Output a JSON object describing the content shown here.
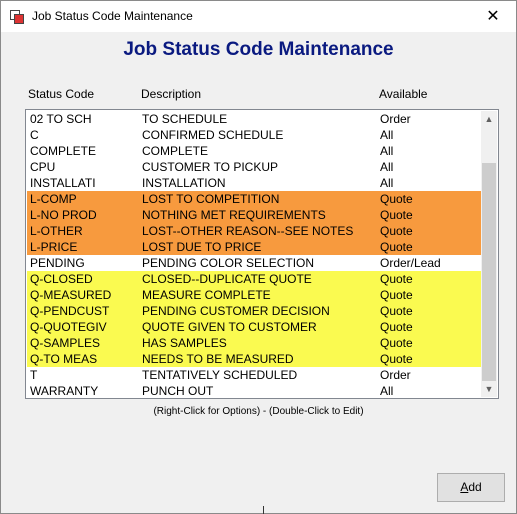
{
  "window": {
    "title": "Job Status Code Maintenance",
    "close_glyph": "✕"
  },
  "heading": "Job Status Code Maintenance",
  "columns": {
    "code": "Status Code",
    "description": "Description",
    "available": "Available"
  },
  "rows": [
    {
      "code": "02 TO SCH",
      "description": "TO SCHEDULE",
      "available": "Order",
      "highlight": "none"
    },
    {
      "code": "C",
      "description": "CONFIRMED SCHEDULE",
      "available": "All",
      "highlight": "none"
    },
    {
      "code": "COMPLETE",
      "description": "COMPLETE",
      "available": "All",
      "highlight": "none"
    },
    {
      "code": "CPU",
      "description": "CUSTOMER TO PICKUP",
      "available": "All",
      "highlight": "none"
    },
    {
      "code": "INSTALLATI",
      "description": "INSTALLATION",
      "available": "All",
      "highlight": "none"
    },
    {
      "code": "L-COMP",
      "description": "LOST TO COMPETITION",
      "available": "Quote",
      "highlight": "orange"
    },
    {
      "code": "L-NO PROD",
      "description": "NOTHING MET REQUIREMENTS",
      "available": "Quote",
      "highlight": "orange"
    },
    {
      "code": "L-OTHER",
      "description": "LOST--OTHER REASON--SEE NOTES",
      "available": "Quote",
      "highlight": "orange"
    },
    {
      "code": "L-PRICE",
      "description": "LOST DUE TO PRICE",
      "available": "Quote",
      "highlight": "orange"
    },
    {
      "code": "PENDING",
      "description": "PENDING COLOR SELECTION",
      "available": "Order/Lead",
      "highlight": "none"
    },
    {
      "code": "Q-CLOSED",
      "description": "CLOSED--DUPLICATE QUOTE",
      "available": "Quote",
      "highlight": "yellow"
    },
    {
      "code": "Q-MEASURED",
      "description": "MEASURE COMPLETE",
      "available": "Quote",
      "highlight": "yellow"
    },
    {
      "code": "Q-PENDCUST",
      "description": "PENDING CUSTOMER DECISION",
      "available": "Quote",
      "highlight": "yellow"
    },
    {
      "code": "Q-QUOTEGIV",
      "description": "QUOTE GIVEN TO CUSTOMER",
      "available": "Quote",
      "highlight": "yellow"
    },
    {
      "code": "Q-SAMPLES",
      "description": "HAS SAMPLES",
      "available": "Quote",
      "highlight": "yellow"
    },
    {
      "code": "Q-TO MEAS",
      "description": "NEEDS TO BE MEASURED",
      "available": "Quote",
      "highlight": "yellow"
    },
    {
      "code": "T",
      "description": "TENTATIVELY SCHEDULED",
      "available": "Order",
      "highlight": "none"
    },
    {
      "code": "WARRANTY",
      "description": "PUNCH OUT",
      "available": "All",
      "highlight": "none"
    }
  ],
  "colors": {
    "orange": "#f79a3e",
    "yellow": "#fafa50",
    "heading": "#0a1a80"
  },
  "scrollbar": {
    "up_glyph": "▲",
    "down_glyph": "▼"
  },
  "hint": "(Right-Click for Options) - (Double-Click to Edit)",
  "add_button": {
    "accel": "A",
    "rest": "dd"
  }
}
